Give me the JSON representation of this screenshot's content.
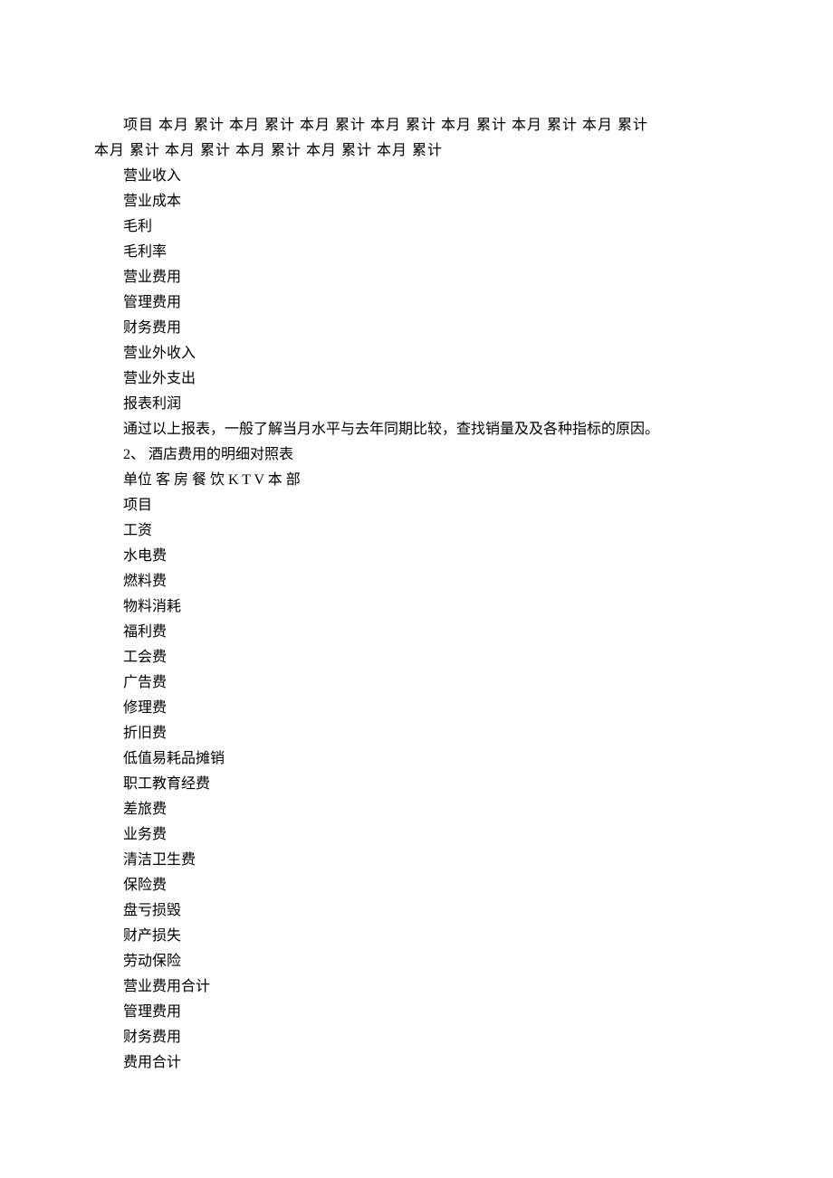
{
  "header": {
    "line1": "项目 本月 累计 本月 累计 本月 累计 本月 累计 本月 累计 本月 累计 本月 累计",
    "line2": "本月 累计 本月 累计 本月 累计 本月 累计 本月 累计"
  },
  "section1": {
    "items": [
      "营业收入",
      "营业成本",
      "毛利",
      "毛利率",
      "营业费用",
      "管理费用",
      "财务费用",
      "营业外收入",
      "营业外支出",
      "报表利润"
    ],
    "summary": "通过以上报表，一般了解当月水平与去年同期比较，查找销量及及各种指标的原因。"
  },
  "section2": {
    "heading": "2、 酒店费用的明细对照表",
    "unit_line": "单位 客 房 餐 饮 K T V 本 部",
    "item_label": "项目",
    "items": [
      "工资",
      "水电费",
      "燃料费",
      "物料消耗",
      "福利费",
      "工会费",
      "广告费",
      "修理费",
      "折旧费",
      "低值易耗品摊销",
      "职工教育经费",
      "差旅费",
      "业务费",
      "清洁卫生费",
      "保险费",
      "盘亏损毁",
      "财产损失",
      "劳动保险",
      "营业费用合计",
      "管理费用",
      "财务费用",
      "费用合计"
    ]
  }
}
